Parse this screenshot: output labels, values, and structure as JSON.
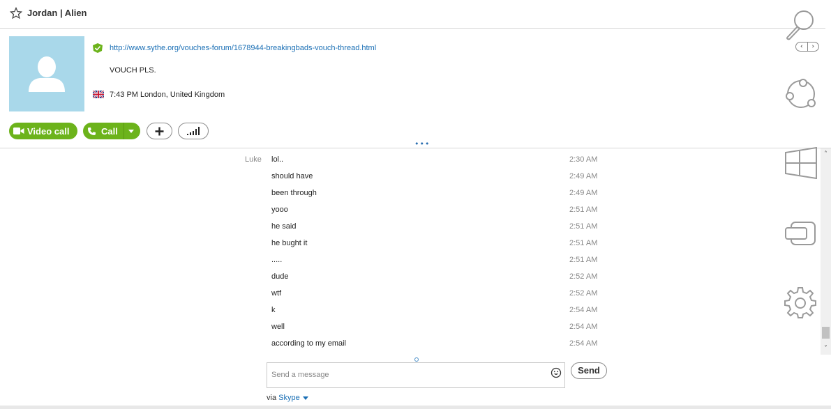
{
  "contact": {
    "name": "Jordan | Alien",
    "mood_link": "http://www.sythe.org/vouches-forum/1678944-breakingbads-vouch-thread.html",
    "status": "VOUCH PLS.",
    "local_time": "7:43 PM London, United Kingdom"
  },
  "actions": {
    "video_call": "Video call",
    "call": "Call"
  },
  "conversation": {
    "sender": "Luke",
    "messages": [
      {
        "text": "lol..",
        "time": "2:30 AM"
      },
      {
        "text": "should have",
        "time": "2:49 AM"
      },
      {
        "text": "been through",
        "time": "2:49 AM"
      },
      {
        "text": "yooo",
        "time": "2:51 AM"
      },
      {
        "text": "he said",
        "time": "2:51 AM"
      },
      {
        "text": "he bught it",
        "time": "2:51 AM"
      },
      {
        "text": ".....",
        "time": "2:51 AM"
      },
      {
        "text": "dude",
        "time": "2:52 AM"
      },
      {
        "text": "wtf",
        "time": "2:52 AM"
      },
      {
        "text": "k",
        "time": "2:54 AM"
      },
      {
        "text": "well",
        "time": "2:54 AM"
      },
      {
        "text": "according to my email",
        "time": "2:54 AM"
      }
    ]
  },
  "composer": {
    "placeholder": "Send a message",
    "send_label": "Send",
    "via_prefix": "via",
    "via_service": "Skype"
  },
  "icons": {
    "favorite": "star-icon",
    "search": "magnifier-icon",
    "mood": "skype-status-icon",
    "flag": "uk-flag-icon",
    "emoji": "smiley-icon",
    "settings": "gear-icon"
  },
  "colors": {
    "accent_green": "#6cb31b",
    "link_blue": "#1a6fb5",
    "avatar_bg": "#a9d8ea"
  }
}
